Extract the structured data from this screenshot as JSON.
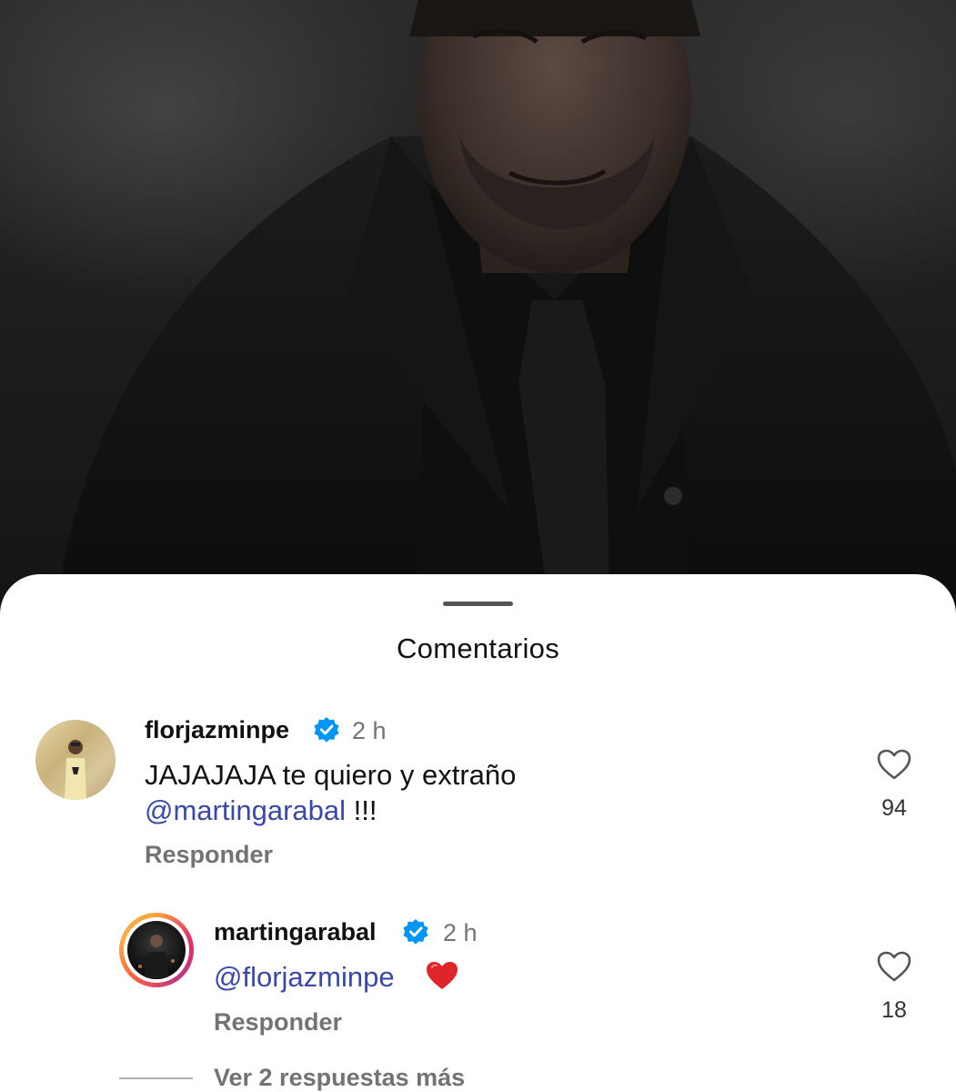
{
  "sheet": {
    "title": "Comentarios"
  },
  "comments": [
    {
      "username": "florjazminpe",
      "verified": true,
      "time": "2 h",
      "text": "JAJAJAJA te quiero y extraño",
      "mention": "@martingarabal",
      "suffix": " !!!",
      "reply_label": "Responder",
      "likes": "94"
    }
  ],
  "replies": [
    {
      "username": "martingarabal",
      "verified": true,
      "time": "2 h",
      "mention": "@florjazminpe",
      "emoji": "red-heart-emoji",
      "reply_label": "Responder",
      "likes": "18"
    }
  ],
  "more_replies": "Ver 2 respuestas más",
  "colors": {
    "mention": "#3949ab",
    "verified": "#0095f6",
    "secondary_text": "#737373"
  },
  "icons": {
    "like": "heart-outline-icon",
    "verified": "verified-badge-icon"
  }
}
